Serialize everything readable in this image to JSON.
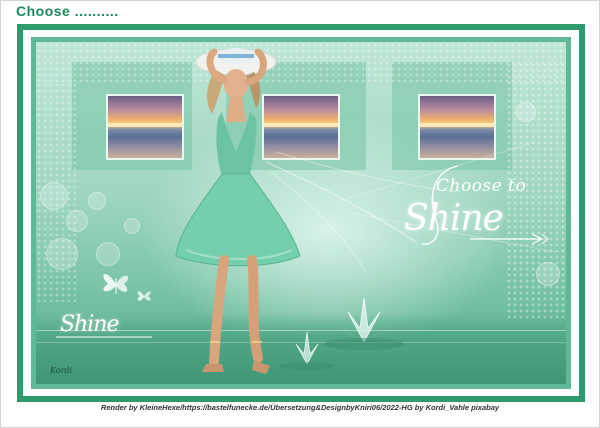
{
  "header": {
    "title": "Choose .........."
  },
  "artwork": {
    "headline": "Choose to",
    "script_word": "Shine",
    "small_script_word": "Shine",
    "signature": "Kordi"
  },
  "footer": {
    "credit": "Render by KleineHexe/https://bastelfunecke.de/Übersetzung&DesignbyKniri06/2022-HG by Kordi_Vahle pixabay"
  },
  "colors": {
    "frame_green": "#2f9a6b",
    "mint": "#9fd6c0",
    "title_green": "#1e8a5a"
  }
}
